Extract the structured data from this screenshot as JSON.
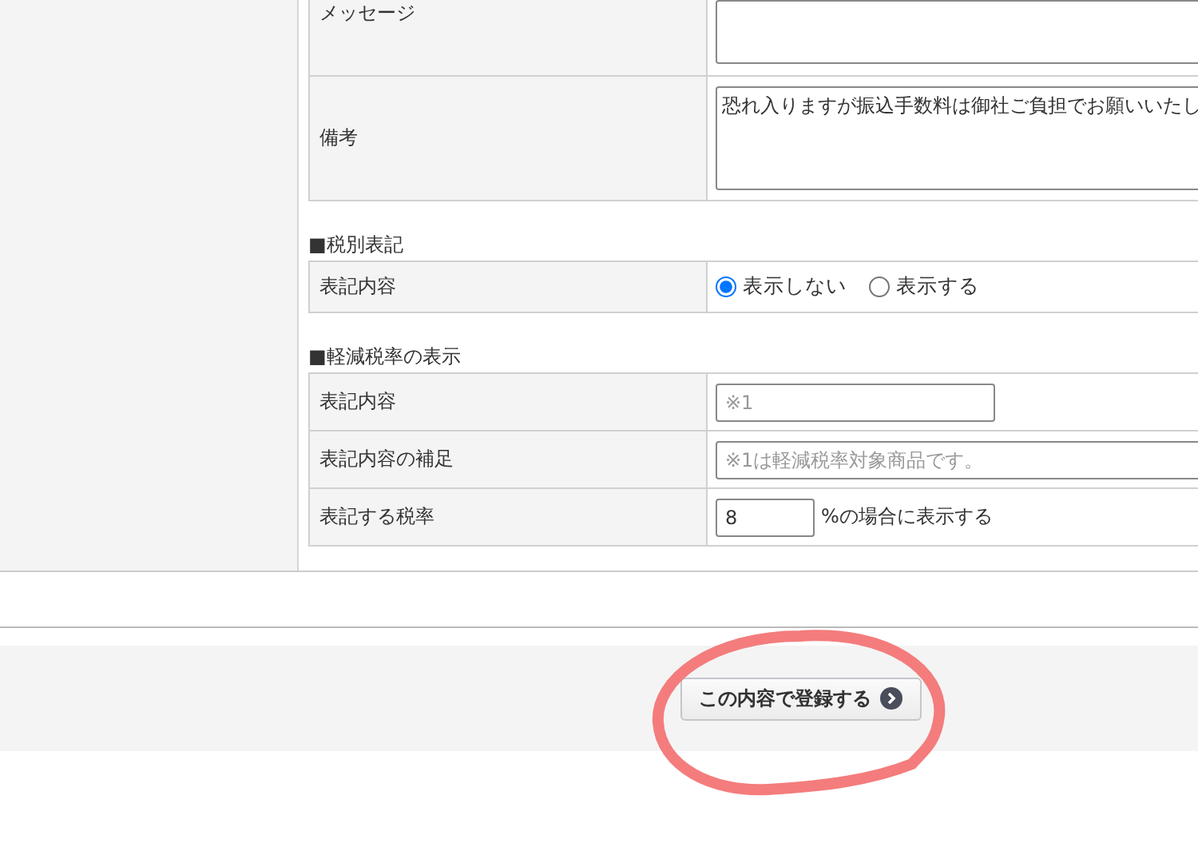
{
  "sections": [
    {
      "rows": [
        {
          "kind": "textarea",
          "label": "メッセージ"
        },
        {
          "kind": "textarea",
          "label": "備考",
          "value": "恐れ入りますが振込手数料は御社ご負担でお願いいたし"
        }
      ]
    },
    {
      "heading": "■税別表記",
      "rows": [
        {
          "kind": "radio",
          "label": "表記内容",
          "options": [
            {
              "label": "表示しない",
              "selected": true
            },
            {
              "label": "表示する",
              "selected": false
            }
          ]
        }
      ]
    },
    {
      "heading": "■軽減税率の表示",
      "rows": [
        {
          "kind": "short_text",
          "label": "表記内容",
          "placeholder": "※1"
        },
        {
          "kind": "text",
          "label": "表記内容の補足",
          "placeholder": "※1は軽減税率対象商品です。"
        },
        {
          "kind": "number",
          "label": "表記する税率",
          "value": "8",
          "suffix": "%の場合に表示する"
        }
      ]
    }
  ],
  "submit_button": {
    "label": "この内容で登録する"
  }
}
